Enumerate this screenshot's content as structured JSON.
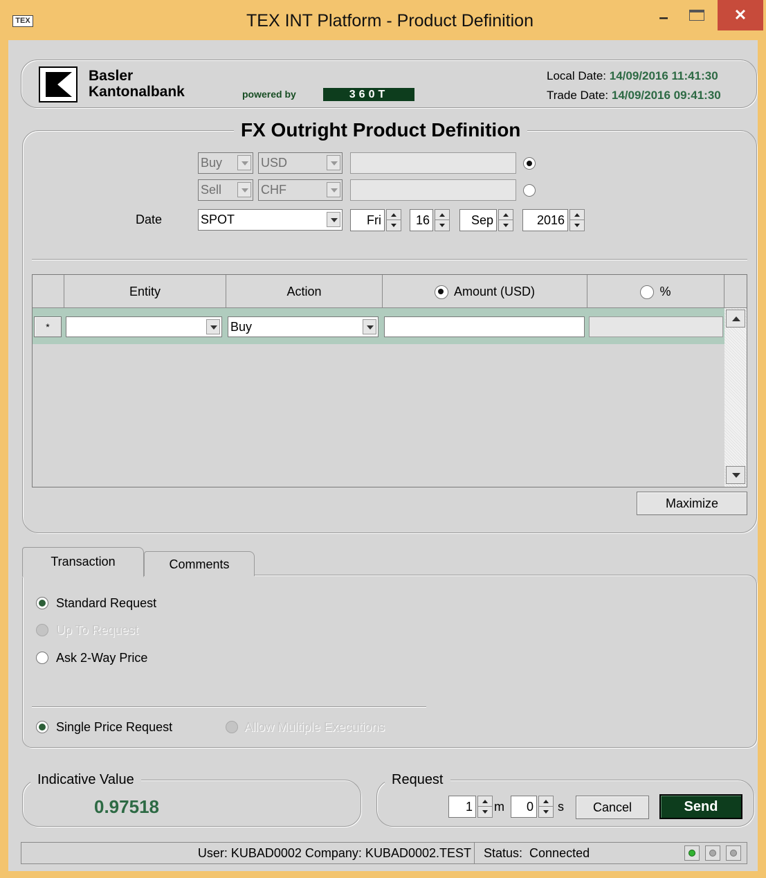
{
  "window": {
    "icon_label": "TEX",
    "title": "TEX INT Platform - Product Definition",
    "minimize": "–",
    "close": "✕"
  },
  "header": {
    "bank_line1": "Basler",
    "bank_line2": "Kantonalbank",
    "powered_by": "powered by",
    "brand_360t": "360T",
    "local_date_label": "Local Date:",
    "local_date_value": "14/09/2016 11:41:30",
    "trade_date_label": "Trade Date:",
    "trade_date_value": "14/09/2016 09:41:30"
  },
  "product": {
    "title": "FX Outright Product Definition",
    "leg1": {
      "side": "Buy",
      "currency": "USD",
      "amount": "",
      "selected": true
    },
    "leg2": {
      "side": "Sell",
      "currency": "CHF",
      "amount": "",
      "selected": false
    },
    "date_label": "Date",
    "tenor": "SPOT",
    "weekday": "Fri",
    "day": "16",
    "month": "Sep",
    "year": "2016"
  },
  "allocation_grid": {
    "columns": [
      "",
      "Entity",
      "Action",
      "Amount (USD)",
      "%"
    ],
    "amount_column_selected": true,
    "percent_column_selected": false,
    "new_row": {
      "marker": "*",
      "entity": "",
      "action": "Buy",
      "amount": "",
      "percent": ""
    }
  },
  "maximize_label": "Maximize",
  "tabs": [
    {
      "label": "Transaction",
      "active": true
    },
    {
      "label": "Comments",
      "active": false
    }
  ],
  "transaction": {
    "standard_request": "Standard Request",
    "up_to_request": "Up To Request",
    "ask_two_way": "Ask 2-Way Price",
    "single_price": "Single Price Request",
    "allow_multiple": "Allow Multiple Executions"
  },
  "indicative": {
    "label": "Indicative Value",
    "value": "0.97518"
  },
  "request": {
    "label": "Request",
    "minutes": "1",
    "minutes_unit": "m",
    "seconds": "0",
    "seconds_unit": "s",
    "cancel": "Cancel",
    "send": "Send"
  },
  "status_bar": {
    "user_info": "User: KUBAD0002 Company: KUBAD0002.TEST",
    "status": "Status:  Connected",
    "indicators": [
      true,
      false,
      false
    ]
  },
  "colors": {
    "window_frame": "#f3c46e",
    "close_button": "#c74b3b",
    "accent_green": "#0d3d1d",
    "date_value": "#2d6a44",
    "grid_row": "#b0ccbe"
  }
}
